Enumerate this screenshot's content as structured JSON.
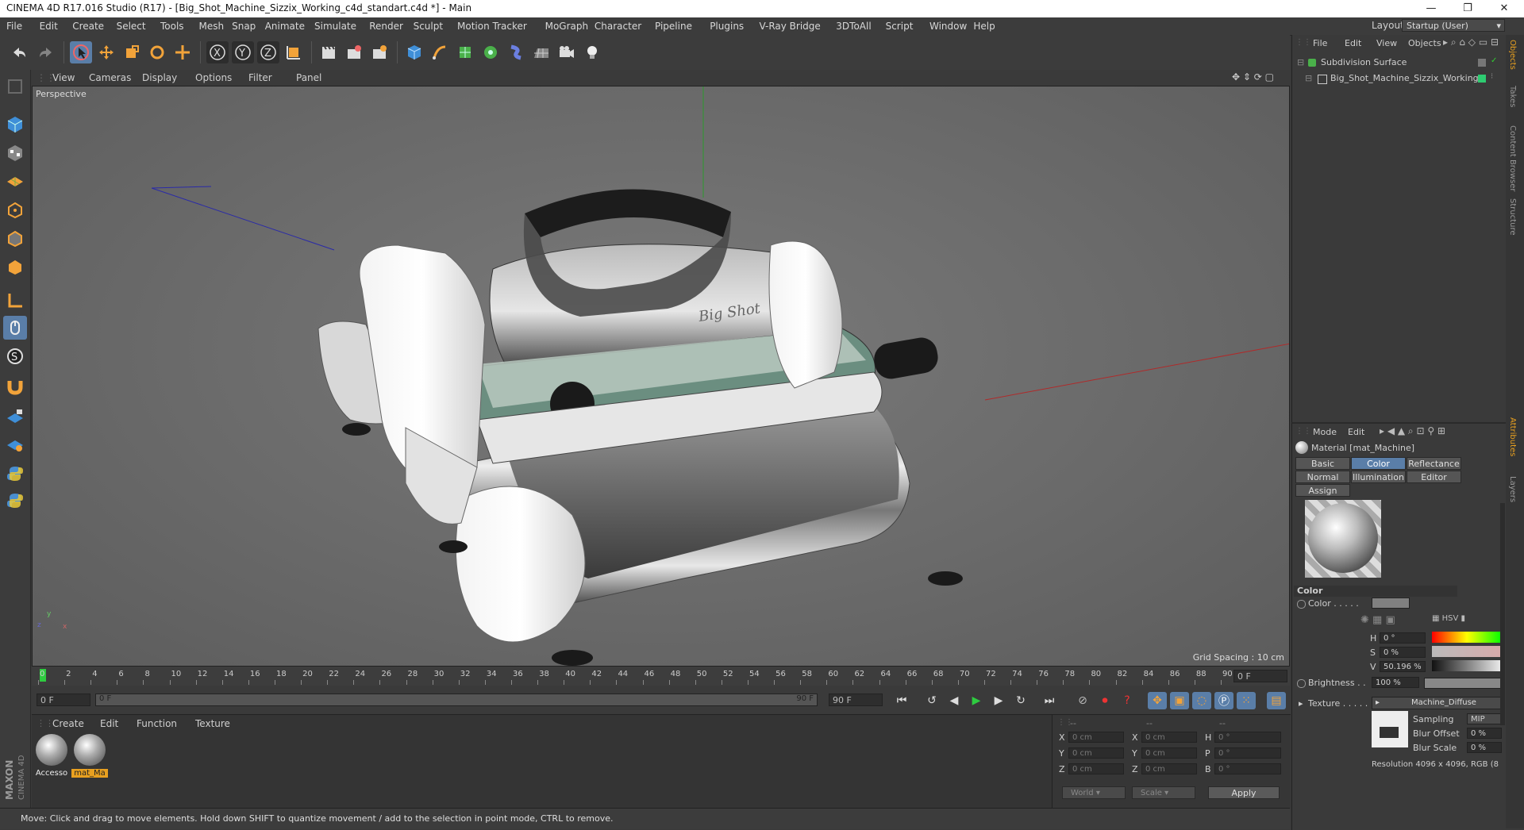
{
  "window": {
    "title": "CINEMA 4D R17.016 Studio (R17) - [Big_Shot_Machine_Sizzix_Working_c4d_standart.c4d *] - Main",
    "minimize": "—",
    "restore": "❐",
    "close": "✕"
  },
  "menu": [
    "File",
    "Edit",
    "Create",
    "Select",
    "Tools",
    "Mesh",
    "Snap",
    "Animate",
    "Simulate",
    "Render",
    "Sculpt",
    "Motion Tracker",
    "MoGraph",
    "Character",
    "Pipeline",
    "Plugins",
    "V-Ray Bridge",
    "3DToAll",
    "Script",
    "Window",
    "Help"
  ],
  "layout": {
    "label": "Layout:",
    "value": "Startup (User)"
  },
  "viewport": {
    "menu": [
      "View",
      "Cameras",
      "Display",
      "Options",
      "Filter",
      "Panel"
    ],
    "camera_label": "Perspective",
    "grid_spacing": "Grid Spacing : 10 cm",
    "axis_x": "x",
    "axis_y": "y",
    "axis_z": "z",
    "model_label_text": "Big Shot"
  },
  "timeline": {
    "ticks": [
      "0",
      "2",
      "4",
      "6",
      "8",
      "10",
      "12",
      "14",
      "16",
      "18",
      "20",
      "22",
      "24",
      "26",
      "28",
      "30",
      "32",
      "34",
      "36",
      "38",
      "40",
      "42",
      "44",
      "46",
      "48",
      "50",
      "52",
      "54",
      "56",
      "58",
      "60",
      "62",
      "64",
      "66",
      "68",
      "70",
      "72",
      "74",
      "76",
      "78",
      "80",
      "82",
      "84",
      "86",
      "88",
      "90"
    ],
    "current_frame": "0 F",
    "start_frame": "0 F",
    "range_start": "0 F",
    "range_end": "90 F",
    "end_frame": "90 F"
  },
  "material_manager": {
    "menu": [
      "Create",
      "Edit",
      "Function",
      "Texture"
    ],
    "materials": [
      {
        "name": "Accesso",
        "selected": false
      },
      {
        "name": "mat_Ma",
        "selected": true
      }
    ]
  },
  "coordinates": {
    "header": [
      "--",
      "--",
      "--"
    ],
    "rows": [
      {
        "a": "X",
        "av": "0 cm",
        "b": "X",
        "bv": "0 cm",
        "c": "H",
        "cv": "0 °"
      },
      {
        "a": "Y",
        "av": "0 cm",
        "b": "Y",
        "bv": "0 cm",
        "c": "P",
        "cv": "0 °"
      },
      {
        "a": "Z",
        "av": "0 cm",
        "b": "Z",
        "bv": "0 cm",
        "c": "B",
        "cv": "0 °"
      }
    ],
    "world": "World",
    "scale": "Scale",
    "apply": "Apply"
  },
  "status": "Move: Click and drag to move elements. Hold down SHIFT to quantize movement / add to the selection in point mode, CTRL to remove.",
  "objects_panel": {
    "menu": [
      "File",
      "Edit",
      "View",
      "Objects"
    ],
    "items": [
      {
        "name": "Subdivision Surface",
        "indent": 0
      },
      {
        "name": "Big_Shot_Machine_Sizzix_Working",
        "indent": 1
      }
    ]
  },
  "side_tabs": [
    "Objects",
    "Takes",
    "Content Browser",
    "Structure",
    "Attributes",
    "Layers"
  ],
  "attributes": {
    "menu": [
      "Mode",
      "Edit"
    ],
    "material_title": "Material [mat_Machine]",
    "tabs": [
      {
        "label": "Basic",
        "active": false
      },
      {
        "label": "Color",
        "active": true
      },
      {
        "label": "Reflectance",
        "active": false
      },
      {
        "label": "Normal",
        "active": false
      },
      {
        "label": "Illumination",
        "active": false
      },
      {
        "label": "Editor",
        "active": false
      },
      {
        "label": "Assign",
        "active": false
      }
    ],
    "section": "Color",
    "color_label": "Color . . . . .",
    "h_label": "H",
    "h_value": "0 °",
    "s_label": "S",
    "s_value": "0 %",
    "v_label": "V",
    "v_value": "50.196 %",
    "brightness_label": "Brightness . .",
    "brightness_value": "100 %",
    "texture_label": "Texture . . . . .",
    "texture_value": "Machine_Diffuse",
    "sampling_label": "Sampling",
    "sampling_value": "MIP",
    "blur_offset_label": "Blur Offset",
    "blur_offset_value": "0 %",
    "blur_scale_label": "Blur Scale",
    "blur_scale_value": "0 %",
    "resolution": "Resolution 4096 x 4096, RGB (8"
  },
  "colors": {
    "accent": "#5a7ea8",
    "selected_material": "#e8a020"
  }
}
